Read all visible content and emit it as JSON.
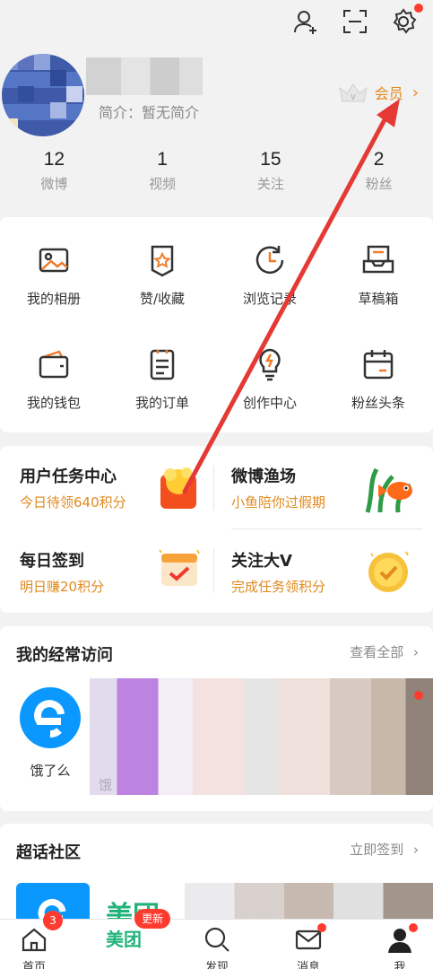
{
  "topbar": {
    "icons": [
      "add-user-icon",
      "scan-icon",
      "settings-icon"
    ]
  },
  "profile": {
    "bio": "简介：暂无简介",
    "vip_label": "会员",
    "vip_chevron": "›"
  },
  "stats": [
    {
      "num": "12",
      "label": "微博"
    },
    {
      "num": "1",
      "label": "视频"
    },
    {
      "num": "15",
      "label": "关注"
    },
    {
      "num": "2",
      "label": "粉丝"
    }
  ],
  "grid": [
    {
      "label": "我的相册",
      "icon": "album-icon"
    },
    {
      "label": "赞/收藏",
      "icon": "favorite-icon"
    },
    {
      "label": "浏览记录",
      "icon": "history-icon"
    },
    {
      "label": "草稿箱",
      "icon": "drafts-icon"
    },
    {
      "label": "我的钱包",
      "icon": "wallet-icon"
    },
    {
      "label": "我的订单",
      "icon": "orders-icon"
    },
    {
      "label": "创作中心",
      "icon": "creation-icon"
    },
    {
      "label": "粉丝头条",
      "icon": "fan-headline-icon"
    }
  ],
  "tasks": [
    {
      "title": "用户任务中心",
      "sub": "今日待领640积分"
    },
    {
      "title": "微博渔场",
      "sub": "小鱼陪你过假期"
    },
    {
      "title": "每日签到",
      "sub": "明日赚20积分"
    },
    {
      "title": "关注大V",
      "sub": "完成任务领积分"
    }
  ],
  "frequent": {
    "title": "我的经常访问",
    "link": "查看全部",
    "chevron": "›",
    "items": [
      {
        "label": "饿了么"
      },
      {
        "label": "饿"
      }
    ]
  },
  "super": {
    "title": "超话社区",
    "link": "立即签到",
    "chevron": "›",
    "meituan": "美团"
  },
  "tabbar": {
    "tabs": [
      {
        "label": "首页",
        "badge": "3"
      },
      {
        "label": "美团",
        "badge": "更新"
      },
      {
        "label": "发现"
      },
      {
        "label": "消息"
      },
      {
        "label": "我"
      }
    ]
  },
  "colors": {
    "accent": "#e08a1f",
    "red": "#ff3b30",
    "arrow": "#e53935"
  }
}
